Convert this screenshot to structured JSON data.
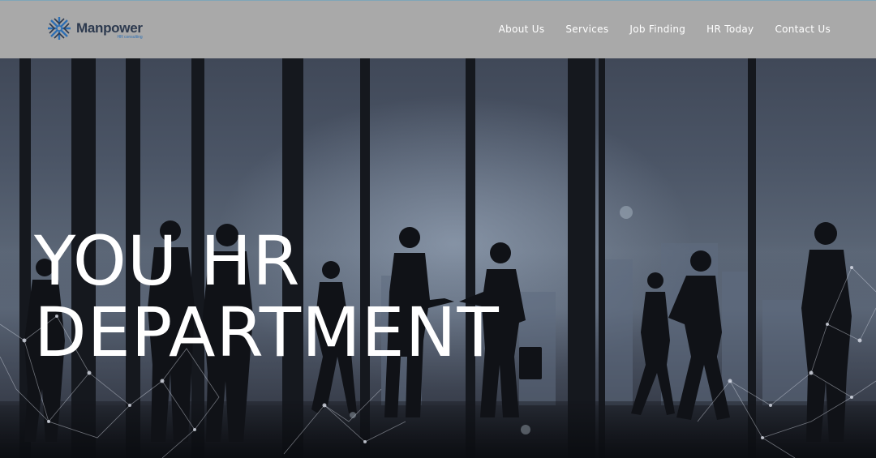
{
  "brand": {
    "name": "Manpower",
    "tagline": "HR consulting"
  },
  "nav": {
    "items": [
      {
        "label": "About Us"
      },
      {
        "label": "Services"
      },
      {
        "label": "Job Finding"
      },
      {
        "label": "HR Today"
      },
      {
        "label": "Contact Us"
      }
    ]
  },
  "hero": {
    "headline_line1": "YOU HR",
    "headline_line2": "DEPARTMENT"
  },
  "colors": {
    "header_bg": "#a9a9a9",
    "logo_dark": "#2d3a4f",
    "logo_accent": "#2d6fb4",
    "nav_text": "#ffffff",
    "headline_text": "#ffffff"
  }
}
